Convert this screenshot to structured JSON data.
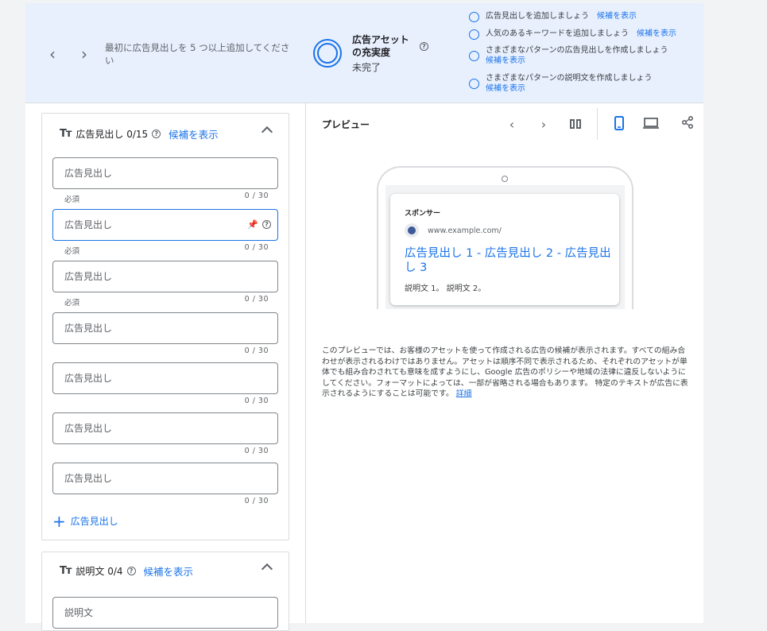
{
  "topbar": {
    "hint": "最初に広告見出しを 5 つ以上追加してください",
    "strength_title": "広告アセットの充実度",
    "strength_status": "未完了",
    "suggestions": [
      {
        "text": "広告見出しを追加しましょう",
        "link": "候補を表示"
      },
      {
        "text": "人気のあるキーワードを追加しましょう",
        "link": "候補を表示"
      },
      {
        "text": "さまざまなパターンの広告見出しを作成しましょう",
        "link": "候補を表示"
      },
      {
        "text": "さまざまなパターンの説明文を作成しましょう",
        "link": "候補を表示"
      }
    ]
  },
  "headlines": {
    "title": "広告見出し 0/15",
    "suggest_link": "候補を表示",
    "fields": [
      {
        "placeholder": "広告見出し",
        "required": "必須",
        "count": "0 / 30"
      },
      {
        "placeholder": "広告見出し",
        "required": "必須",
        "count": "0 / 30"
      },
      {
        "placeholder": "広告見出し",
        "required": "必須",
        "count": "0 / 30"
      },
      {
        "placeholder": "広告見出し",
        "required": "",
        "count": "0 / 30"
      },
      {
        "placeholder": "広告見出し",
        "required": "",
        "count": "0 / 30"
      },
      {
        "placeholder": "広告見出し",
        "required": "",
        "count": "0 / 30"
      },
      {
        "placeholder": "広告見出し",
        "required": "",
        "count": "0 / 30"
      }
    ],
    "add_label": "広告見出し"
  },
  "descriptions": {
    "title": "説明文 0/4",
    "suggest_link": "候補を表示",
    "first_placeholder": "説明文"
  },
  "preview": {
    "title": "プレビュー",
    "sponsor": "スポンサー",
    "url": "www.example.com/",
    "ad_title": "広告見出し 1 - 広告見出し 2 - 広告見出し 3",
    "ad_desc": "説明文 1。 説明文 2。",
    "note": "このプレビューでは、お客様のアセットを使って作成される広告の候補が表示されます。すべての組み合わせが表示されるわけではありません。アセットは順序不同で表示されるため、それぞれのアセットが単体でも組み合わされても意味を成すようにし、Google 広告のポリシーや地域の法律に違反しないようにしてください。フォーマットによっては、一部が省略される場合もあります。 特定のテキストが広告に表示されるようにすることは可能です。",
    "note_link": "詳細"
  },
  "colors": {
    "accent": "#1a73e8",
    "banner": "#e8f0fe"
  }
}
